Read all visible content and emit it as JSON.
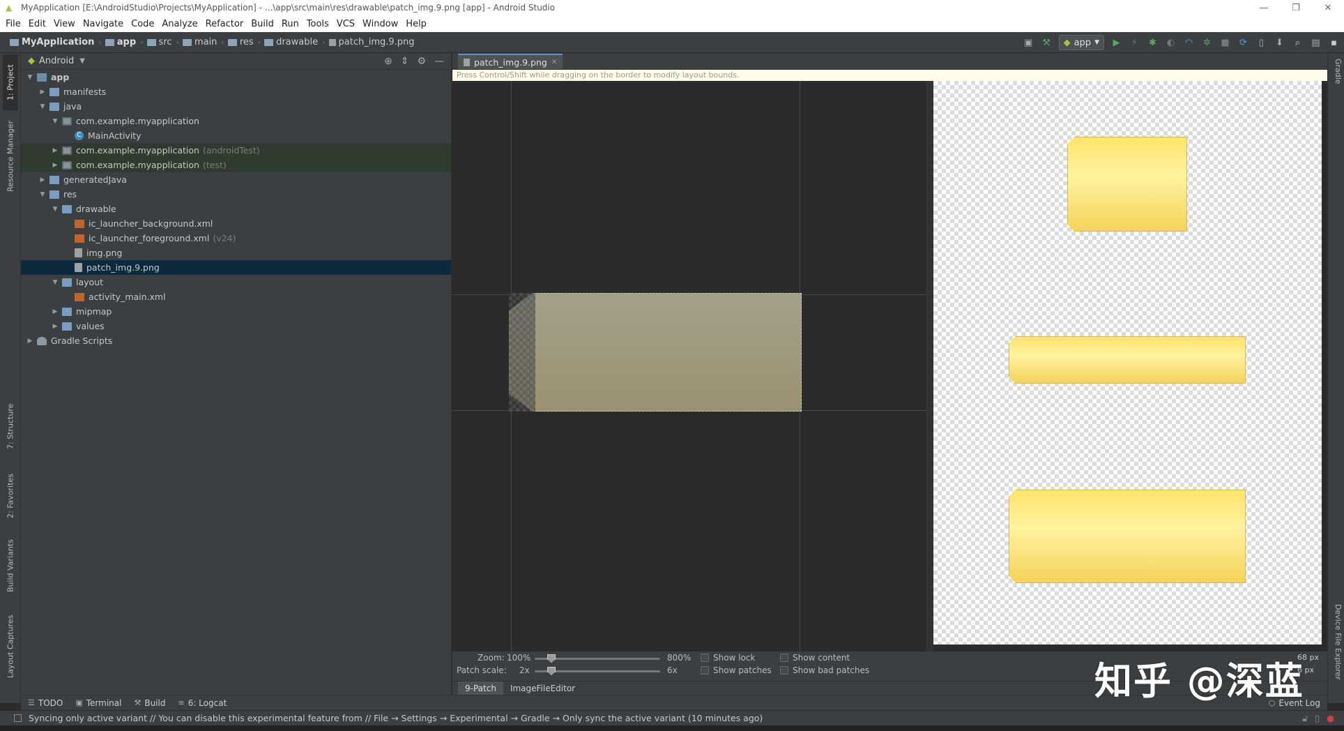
{
  "window": {
    "title": "MyApplication [E:\\AndroidStudio\\Projects\\MyApplication] - ...\\app\\src\\main\\res\\drawable\\patch_img.9.png [app] - Android Studio",
    "controls": [
      "—",
      "❐",
      "✕"
    ]
  },
  "menu": [
    "File",
    "Edit",
    "View",
    "Navigate",
    "Code",
    "Analyze",
    "Refactor",
    "Build",
    "Run",
    "Tools",
    "VCS",
    "Window",
    "Help"
  ],
  "breadcrumbs": [
    "MyApplication",
    "app",
    "src",
    "main",
    "res",
    "drawable",
    "patch_img.9.png"
  ],
  "toolbar": {
    "run_config": "app"
  },
  "left_tool_windows": [
    "1: Project",
    "Resource Manager",
    "7: Structure",
    "2: Favorites",
    "Build Variants",
    "Layout Captures"
  ],
  "right_tool_windows": [
    "Gradle",
    "Device File Explorer"
  ],
  "project_panel": {
    "view": "Android",
    "tree": [
      {
        "label": "app",
        "suffix": "",
        "icon": "app-module-icon",
        "expanded": true
      },
      {
        "label": "manifests",
        "suffix": "",
        "icon": "folder-icon",
        "expanded": false
      },
      {
        "label": "java",
        "suffix": "",
        "icon": "folder-icon",
        "expanded": true
      },
      {
        "label": "com.example.myapplication",
        "suffix": "",
        "icon": "package-icon",
        "expanded": true
      },
      {
        "label": "MainActivity",
        "suffix": "",
        "icon": "class-icon"
      },
      {
        "label": "com.example.myapplication",
        "suffix": "(androidTest)",
        "icon": "package-icon",
        "expanded": false
      },
      {
        "label": "com.example.myapplication",
        "suffix": "(test)",
        "icon": "package-icon",
        "expanded": false
      },
      {
        "label": "generatedJava",
        "suffix": "",
        "icon": "folder-icon",
        "expanded": false
      },
      {
        "label": "res",
        "suffix": "",
        "icon": "folder-icon",
        "expanded": true
      },
      {
        "label": "drawable",
        "suffix": "",
        "icon": "folder-icon",
        "expanded": true
      },
      {
        "label": "ic_launcher_background.xml",
        "suffix": "",
        "icon": "xml-file-icon"
      },
      {
        "label": "ic_launcher_foreground.xml",
        "suffix": "(v24)",
        "icon": "xml-file-icon"
      },
      {
        "label": "img.png",
        "suffix": "",
        "icon": "image-file-icon"
      },
      {
        "label": "patch_img.9.png",
        "suffix": "",
        "icon": "image-file-icon",
        "selected": true
      },
      {
        "label": "layout",
        "suffix": "",
        "icon": "folder-icon",
        "expanded": true
      },
      {
        "label": "activity_main.xml",
        "suffix": "",
        "icon": "xml-file-icon"
      },
      {
        "label": "mipmap",
        "suffix": "",
        "icon": "folder-icon",
        "expanded": false
      },
      {
        "label": "values",
        "suffix": "",
        "icon": "folder-icon",
        "expanded": false
      },
      {
        "label": "Gradle Scripts",
        "suffix": "",
        "icon": "gradle-icon",
        "expanded": false
      }
    ]
  },
  "editor": {
    "tab": "patch_img.9.png",
    "hint": "Press Control/Shift while dragging on the border to modify layout bounds.",
    "zoom_label": "Zoom:",
    "zoom_value": "100%",
    "zoom_max": "800%",
    "zoom_level": 0.0,
    "patch_scale_label": "Patch scale:",
    "patch_scale_value": "2x",
    "patch_scale_max": "6x",
    "patch_scale_level": 0.0,
    "checkboxes": {
      "show_lock": "Show lock",
      "show_patches": "Show patches",
      "show_content": "Show content",
      "show_bad_patches": "Show bad patches"
    },
    "px_top": "68 px",
    "px_bottom": "6 px",
    "sub_tabs": [
      "9-Patch",
      "ImageFileEditor"
    ]
  },
  "bottom_tools": [
    "TODO",
    "Terminal",
    "Build",
    "6: Logcat"
  ],
  "event_log": "Event Log",
  "status": "Syncing only active variant // You can disable this experimental feature from // File → Settings → Experimental → Gradle → Only sync the active variant (10 minutes ago)",
  "watermark": "知乎 @深蓝",
  "colors": {
    "accent": "#6a8fb4",
    "selection": "#0d293e",
    "patch_fill": "#a3a08a",
    "preview_fill": "#ffe36a"
  }
}
